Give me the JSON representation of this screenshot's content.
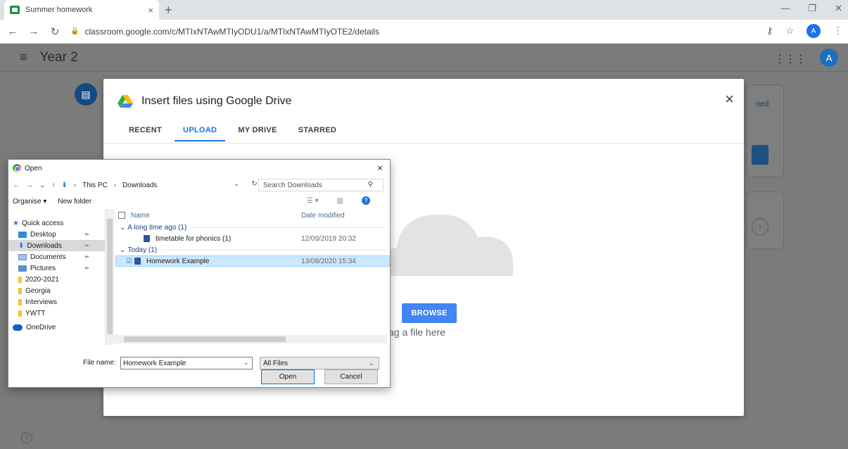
{
  "browser": {
    "tab_title": "Summer homework",
    "tab_close": "×",
    "new_tab": "+",
    "url": "classroom.google.com/c/MTIxNTAwMTIyODU1/a/MTIxNTAwMTIyOTE2/details",
    "account_initial": "A"
  },
  "classroom": {
    "class_name": "Year 2",
    "account_initial": "A",
    "side_card_text": "ned",
    "help": "?"
  },
  "drive_picker": {
    "title": "Insert files using Google Drive",
    "close": "×",
    "tabs": [
      {
        "label": "RECENT"
      },
      {
        "label": "UPLOAD",
        "active": true
      },
      {
        "label": "MY DRIVE"
      },
      {
        "label": "STARRED"
      }
    ],
    "browse_label": "BROWSE",
    "drag_text": "r drag a file here"
  },
  "open_dialog": {
    "title": "Open",
    "close": "×",
    "path": [
      "This PC",
      "Downloads"
    ],
    "search_placeholder": "Search Downloads",
    "toolbar": {
      "organise": "Organise ▾",
      "new_folder": "New folder"
    },
    "nav_items": [
      {
        "label": "Quick access",
        "icon": "star-icon"
      },
      {
        "label": "Desktop",
        "icon": "desktop-icon",
        "pinned": true
      },
      {
        "label": "Downloads",
        "icon": "downloads-icon",
        "pinned": true,
        "selected": true
      },
      {
        "label": "Documents",
        "icon": "documents-icon",
        "pinned": true
      },
      {
        "label": "Pictures",
        "icon": "pictures-icon",
        "pinned": true
      },
      {
        "label": "2020-2021",
        "icon": "folder-icon"
      },
      {
        "label": "Georgia",
        "icon": "folder-icon"
      },
      {
        "label": "Interviews",
        "icon": "folder-icon"
      },
      {
        "label": "YWTT",
        "icon": "folder-icon"
      },
      {
        "label": "OneDrive",
        "icon": "onedrive-icon"
      }
    ],
    "columns": {
      "name": "Name",
      "date": "Date modified"
    },
    "groups": [
      {
        "label": "A long time ago (1)",
        "files": [
          {
            "name": "timetable for phonics (1)",
            "date": "12/09/2019 20:32"
          }
        ]
      },
      {
        "label": "Today (1)",
        "files": [
          {
            "name": "Homework Example",
            "date": "13/08/2020 15:34",
            "selected": true
          }
        ]
      }
    ],
    "file_name_label": "File name:",
    "file_name_value": "Homework Example",
    "file_type": "All Files",
    "open_label": "Open",
    "cancel_label": "Cancel"
  }
}
